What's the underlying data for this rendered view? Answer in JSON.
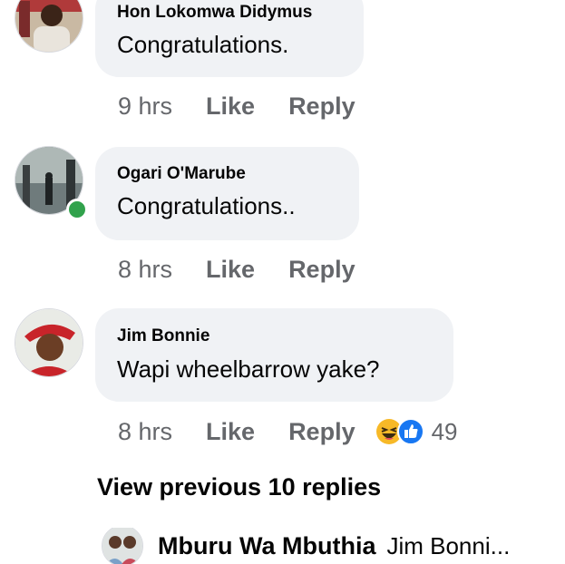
{
  "comments": [
    {
      "author": "Hon Lokomwa Didymus",
      "text": "Congratulations.",
      "time": "9 hrs",
      "like_label": "Like",
      "reply_label": "Reply",
      "avatar_icon": "profile-photo-icon"
    },
    {
      "author": "Ogari O'Marube",
      "text": "Congratulations..",
      "time": "8 hrs",
      "like_label": "Like",
      "reply_label": "Reply",
      "online": true,
      "avatar_icon": "profile-photo-icon"
    },
    {
      "author": "Jim Bonnie",
      "text": "Wapi wheelbarrow yake?",
      "time": "8 hrs",
      "like_label": "Like",
      "reply_label": "Reply",
      "reactions": {
        "icons": [
          "laugh-reaction-icon",
          "like-reaction-icon"
        ],
        "count": "49"
      },
      "avatar_icon": "profile-photo-icon"
    }
  ],
  "view_previous": "View previous 10 replies",
  "latest_reply": {
    "author": "Mburu Wa Mbuthia",
    "text": "Jim Bonni..."
  },
  "colors": {
    "bubble": "#f0f2f5",
    "meta_text": "#65676b",
    "online": "#31a24c",
    "like_blue": "#1877f2",
    "laugh_yellow": "#f7b928"
  }
}
